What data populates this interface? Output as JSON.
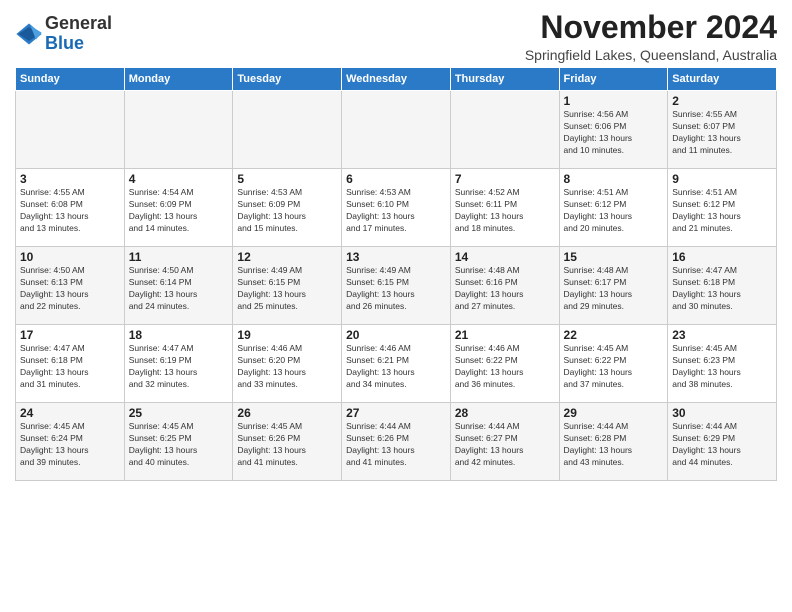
{
  "logo": {
    "general": "General",
    "blue": "Blue"
  },
  "header": {
    "title": "November 2024",
    "location": "Springfield Lakes, Queensland, Australia"
  },
  "weekdays": [
    "Sunday",
    "Monday",
    "Tuesday",
    "Wednesday",
    "Thursday",
    "Friday",
    "Saturday"
  ],
  "weeks": [
    [
      {
        "day": "",
        "info": ""
      },
      {
        "day": "",
        "info": ""
      },
      {
        "day": "",
        "info": ""
      },
      {
        "day": "",
        "info": ""
      },
      {
        "day": "",
        "info": ""
      },
      {
        "day": "1",
        "info": "Sunrise: 4:56 AM\nSunset: 6:06 PM\nDaylight: 13 hours\nand 10 minutes."
      },
      {
        "day": "2",
        "info": "Sunrise: 4:55 AM\nSunset: 6:07 PM\nDaylight: 13 hours\nand 11 minutes."
      }
    ],
    [
      {
        "day": "3",
        "info": "Sunrise: 4:55 AM\nSunset: 6:08 PM\nDaylight: 13 hours\nand 13 minutes."
      },
      {
        "day": "4",
        "info": "Sunrise: 4:54 AM\nSunset: 6:09 PM\nDaylight: 13 hours\nand 14 minutes."
      },
      {
        "day": "5",
        "info": "Sunrise: 4:53 AM\nSunset: 6:09 PM\nDaylight: 13 hours\nand 15 minutes."
      },
      {
        "day": "6",
        "info": "Sunrise: 4:53 AM\nSunset: 6:10 PM\nDaylight: 13 hours\nand 17 minutes."
      },
      {
        "day": "7",
        "info": "Sunrise: 4:52 AM\nSunset: 6:11 PM\nDaylight: 13 hours\nand 18 minutes."
      },
      {
        "day": "8",
        "info": "Sunrise: 4:51 AM\nSunset: 6:12 PM\nDaylight: 13 hours\nand 20 minutes."
      },
      {
        "day": "9",
        "info": "Sunrise: 4:51 AM\nSunset: 6:12 PM\nDaylight: 13 hours\nand 21 minutes."
      }
    ],
    [
      {
        "day": "10",
        "info": "Sunrise: 4:50 AM\nSunset: 6:13 PM\nDaylight: 13 hours\nand 22 minutes."
      },
      {
        "day": "11",
        "info": "Sunrise: 4:50 AM\nSunset: 6:14 PM\nDaylight: 13 hours\nand 24 minutes."
      },
      {
        "day": "12",
        "info": "Sunrise: 4:49 AM\nSunset: 6:15 PM\nDaylight: 13 hours\nand 25 minutes."
      },
      {
        "day": "13",
        "info": "Sunrise: 4:49 AM\nSunset: 6:15 PM\nDaylight: 13 hours\nand 26 minutes."
      },
      {
        "day": "14",
        "info": "Sunrise: 4:48 AM\nSunset: 6:16 PM\nDaylight: 13 hours\nand 27 minutes."
      },
      {
        "day": "15",
        "info": "Sunrise: 4:48 AM\nSunset: 6:17 PM\nDaylight: 13 hours\nand 29 minutes."
      },
      {
        "day": "16",
        "info": "Sunrise: 4:47 AM\nSunset: 6:18 PM\nDaylight: 13 hours\nand 30 minutes."
      }
    ],
    [
      {
        "day": "17",
        "info": "Sunrise: 4:47 AM\nSunset: 6:18 PM\nDaylight: 13 hours\nand 31 minutes."
      },
      {
        "day": "18",
        "info": "Sunrise: 4:47 AM\nSunset: 6:19 PM\nDaylight: 13 hours\nand 32 minutes."
      },
      {
        "day": "19",
        "info": "Sunrise: 4:46 AM\nSunset: 6:20 PM\nDaylight: 13 hours\nand 33 minutes."
      },
      {
        "day": "20",
        "info": "Sunrise: 4:46 AM\nSunset: 6:21 PM\nDaylight: 13 hours\nand 34 minutes."
      },
      {
        "day": "21",
        "info": "Sunrise: 4:46 AM\nSunset: 6:22 PM\nDaylight: 13 hours\nand 36 minutes."
      },
      {
        "day": "22",
        "info": "Sunrise: 4:45 AM\nSunset: 6:22 PM\nDaylight: 13 hours\nand 37 minutes."
      },
      {
        "day": "23",
        "info": "Sunrise: 4:45 AM\nSunset: 6:23 PM\nDaylight: 13 hours\nand 38 minutes."
      }
    ],
    [
      {
        "day": "24",
        "info": "Sunrise: 4:45 AM\nSunset: 6:24 PM\nDaylight: 13 hours\nand 39 minutes."
      },
      {
        "day": "25",
        "info": "Sunrise: 4:45 AM\nSunset: 6:25 PM\nDaylight: 13 hours\nand 40 minutes."
      },
      {
        "day": "26",
        "info": "Sunrise: 4:45 AM\nSunset: 6:26 PM\nDaylight: 13 hours\nand 41 minutes."
      },
      {
        "day": "27",
        "info": "Sunrise: 4:44 AM\nSunset: 6:26 PM\nDaylight: 13 hours\nand 41 minutes."
      },
      {
        "day": "28",
        "info": "Sunrise: 4:44 AM\nSunset: 6:27 PM\nDaylight: 13 hours\nand 42 minutes."
      },
      {
        "day": "29",
        "info": "Sunrise: 4:44 AM\nSunset: 6:28 PM\nDaylight: 13 hours\nand 43 minutes."
      },
      {
        "day": "30",
        "info": "Sunrise: 4:44 AM\nSunset: 6:29 PM\nDaylight: 13 hours\nand 44 minutes."
      }
    ]
  ]
}
